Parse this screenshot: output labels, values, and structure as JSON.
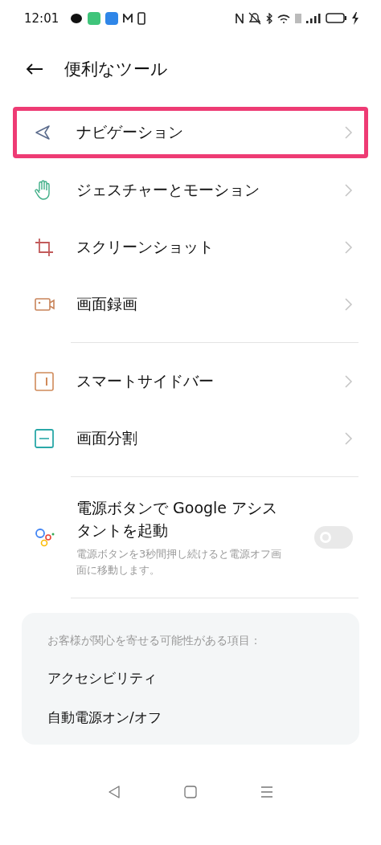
{
  "status_bar": {
    "time": "12:01"
  },
  "header": {
    "title": "便利なツール"
  },
  "sections": [
    {
      "items": [
        {
          "kind": "link",
          "label": "ナビゲーション",
          "highlighted": true
        },
        {
          "kind": "link",
          "label": "ジェスチャーとモーション",
          "highlighted": false
        },
        {
          "kind": "link",
          "label": "スクリーンショット",
          "highlighted": false
        },
        {
          "kind": "link",
          "label": "画面録画",
          "highlighted": false
        }
      ]
    },
    {
      "items": [
        {
          "kind": "link",
          "label": "スマートサイドバー",
          "highlighted": false
        },
        {
          "kind": "link",
          "label": "画面分割",
          "highlighted": false
        }
      ]
    },
    {
      "items": [
        {
          "kind": "toggle",
          "label": "電源ボタンで Google アシスタントを起動",
          "description": "電源ボタンを3秒間押し続けると電源オフ画面に移動します。",
          "on": false
        }
      ]
    }
  ],
  "suggestions": {
    "heading": "お客様が関心を寄せる可能性がある項目：",
    "items": [
      "アクセシビリティ",
      "自動電源オン/オフ"
    ]
  }
}
